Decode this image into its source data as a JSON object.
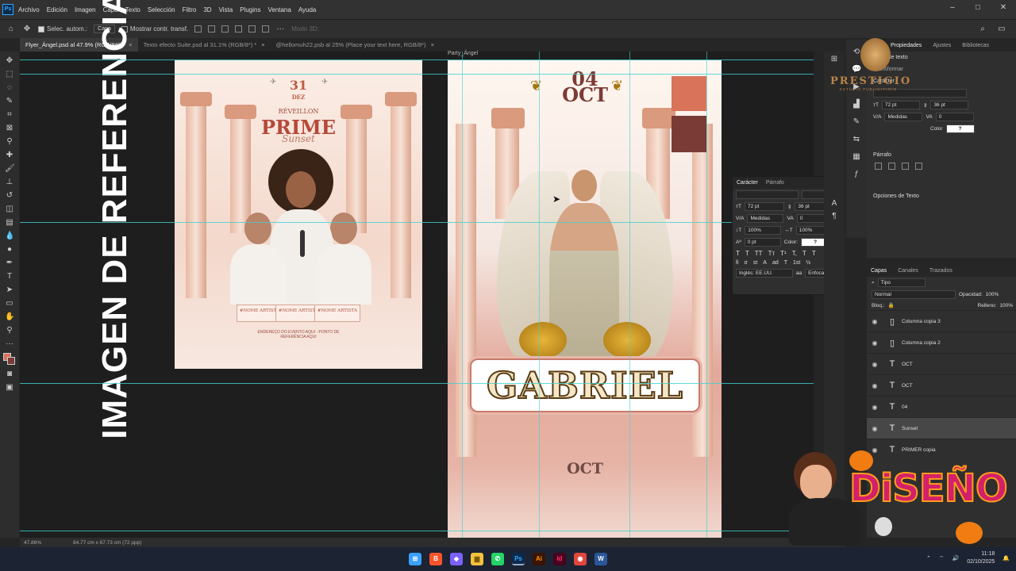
{
  "app": {
    "logo_text": "Ps"
  },
  "menu": [
    "Archivo",
    "Edición",
    "Imagen",
    "Capa",
    "Texto",
    "Selección",
    "Filtro",
    "3D",
    "Vista",
    "Plugins",
    "Ventana",
    "Ayuda"
  ],
  "window_controls": {
    "minimize": "–",
    "maximize": "□",
    "close": "✕"
  },
  "options_bar": {
    "auto_select_label": "Selec. autom.:",
    "auto_select_value": "Capa",
    "show_transform_label": "Mostrar contr. transf.",
    "mode_3d_label": "Modo 3D:"
  },
  "tabs": [
    {
      "label": "Flyer_Ángel.psd al 47.9% (RGB/8#) *",
      "close": "×"
    },
    {
      "label": "Texto efecto Suite.psd al 31.1% (RGB/8*) *",
      "close": "×"
    },
    {
      "label": "@hellomuh22.psb al 25% (Place your text here, RGB/8*)",
      "close": "×"
    }
  ],
  "canvas": {
    "reference_text": "IMAGEN DE REFERENCIA",
    "poster1": {
      "day": "31",
      "month": "DEZ",
      "subtitle": "RÉVEILLON",
      "title": "PRIME",
      "script": "Sunset",
      "artists": [
        "#NOME ARTISTA",
        "#NOME ARTISTA",
        "#NOME ARTISTA"
      ],
      "address": "ENDEREÇO DO EVENTO AQUI · PONTO DE REFERÊNCIA AQUI"
    },
    "poster2": {
      "label": "Party_Ángel",
      "day": "04",
      "month": "OCT",
      "name": "GABRIEL",
      "bottom_month": "OCT"
    },
    "swatch_colors": [
      "#d9735a",
      "#7a3b36"
    ]
  },
  "character_panel": {
    "tabs": [
      "Carácter",
      "Párrafo"
    ],
    "size": "72 pt",
    "leading": "36 pt",
    "kerning": "Medidas",
    "tracking": "0",
    "vscale": "100%",
    "hscale": "100%",
    "baseline": "0 pt",
    "color_label": "Color:",
    "color_value": "?",
    "language": "Inglés: EE.UU.",
    "antialias": "Enfocado",
    "format_buttons": [
      "T",
      "T",
      "TT",
      "Tт",
      "T¹",
      "T,",
      "T",
      "T"
    ],
    "ot_buttons": [
      "fi",
      "σ",
      "st",
      "A",
      "ad",
      "T",
      "1st",
      "½"
    ]
  },
  "properties_panel": {
    "tabs": [
      "Propiedades",
      "Ajustes",
      "Bibliotecas"
    ],
    "section_title": "Transformar",
    "layer_type": "Capa de texto",
    "char_header": "Carácter",
    "size": "72 pt",
    "leading": "36 pt",
    "kerning": "Medidas",
    "tracking": "0",
    "color_label": "Color",
    "color_value": "?",
    "para_header": "Párrafo",
    "text_options": "Opciones de Texto"
  },
  "layers_panel": {
    "tabs": [
      "Capas",
      "Canales",
      "Trazados"
    ],
    "filter": "Tipo",
    "blend_mode": "Normal",
    "opacity_label": "Opacidad:",
    "opacity": "100%",
    "lock_label": "Bloq.:",
    "fill_label": "Relleno:",
    "fill": "100%",
    "layers": [
      {
        "name": "Columna copia 3",
        "type": "image",
        "selected": false
      },
      {
        "name": "Columna copia 2",
        "type": "image",
        "selected": false
      },
      {
        "name": "OCT",
        "type": "text",
        "selected": false
      },
      {
        "name": "OCT",
        "type": "text",
        "selected": false
      },
      {
        "name": "04",
        "type": "text",
        "selected": false
      },
      {
        "name": "Sunset",
        "type": "text",
        "selected": true
      },
      {
        "name": "PRIMER copia",
        "type": "text",
        "selected": false
      }
    ]
  },
  "status_bar": {
    "zoom": "47.86%",
    "doc_info": "84.77 cm x 67.73 cm (72 ppp)"
  },
  "watermarks": {
    "logo_text": "PRESTIGIO",
    "logo_sub": "ESTUDIO PUBLICITARIO",
    "brand": "DiSEÑO"
  },
  "taskbar": {
    "apps": [
      {
        "name": "Windows",
        "glyph": "⊞",
        "color": "#3aa0ff"
      },
      {
        "name": "Brave",
        "glyph": "B",
        "color": "#fb542b"
      },
      {
        "name": "Copilot",
        "glyph": "◆",
        "color": "#7b61ff"
      },
      {
        "name": "Explorador",
        "glyph": "▆",
        "color": "#f5c33b"
      },
      {
        "name": "WhatsApp",
        "glyph": "✆",
        "color": "#25d366"
      },
      {
        "name": "Photoshop",
        "glyph": "Ps",
        "color": "#0c2a4a"
      },
      {
        "name": "Illustrator",
        "glyph": "Ai",
        "color": "#3a1400"
      },
      {
        "name": "InDesign",
        "glyph": "Id",
        "color": "#49021f"
      },
      {
        "name": "Chrome",
        "glyph": "◉",
        "color": "#e0463b"
      },
      {
        "name": "Word",
        "glyph": "W",
        "color": "#2b579a"
      }
    ],
    "time": "11:18",
    "date": "02/10/2025"
  }
}
